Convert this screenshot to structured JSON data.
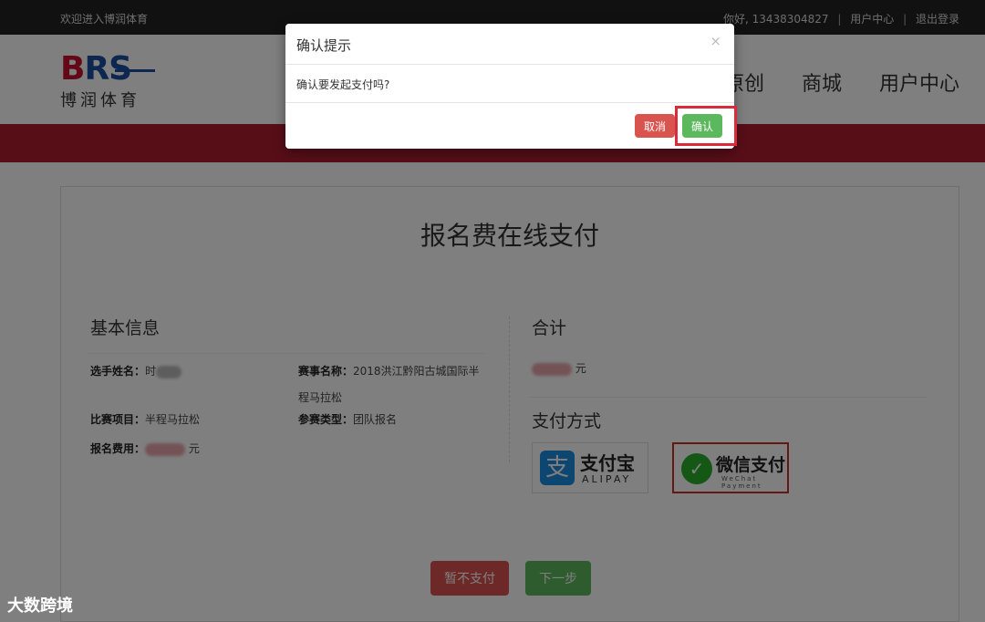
{
  "topbar": {
    "welcome": "欢迎进入博润体育",
    "greeting": "你好, 13438304827",
    "user_center": "用户中心",
    "logout": "退出登录"
  },
  "header": {
    "logo_text": "BRS",
    "logo_cn": "博润体育",
    "nav": [
      "原创",
      "商城",
      "用户中心"
    ]
  },
  "page": {
    "title": "报名费在线支付",
    "basic_info": {
      "heading": "基本信息",
      "player_name_label": "选手姓名：",
      "player_name_value": "时",
      "event_name_label": "赛事名称：",
      "event_name_value_line1": "2018洪江黔阳古城国际半",
      "event_name_value_line2": "程马拉松",
      "item_label": "比赛项目：",
      "item_value": "半程马拉松",
      "type_label": "参赛类型：",
      "type_value": "团队报名",
      "fee_label": "报名费用：",
      "fee_unit": "元"
    },
    "total": {
      "heading": "合计",
      "unit": "元"
    },
    "payment": {
      "heading": "支付方式",
      "alipay_icon": "支",
      "alipay_cn": "支付宝",
      "alipay_en": "ALIPAY",
      "wechat_icon": "✓",
      "wechat_cn": "微信支付",
      "wechat_en": "WeChat Payment"
    },
    "buttons": {
      "skip": "暂不支付",
      "next": "下一步"
    }
  },
  "modal": {
    "title": "确认提示",
    "close": "×",
    "message": "确认要发起支付吗?",
    "cancel": "取消",
    "confirm": "确认"
  },
  "colors": {
    "brand_red": "#b01c2e",
    "cancel": "#d9534f",
    "confirm": "#5cb85c",
    "highlight": "#d92b3a"
  },
  "watermark": "大数跨境"
}
